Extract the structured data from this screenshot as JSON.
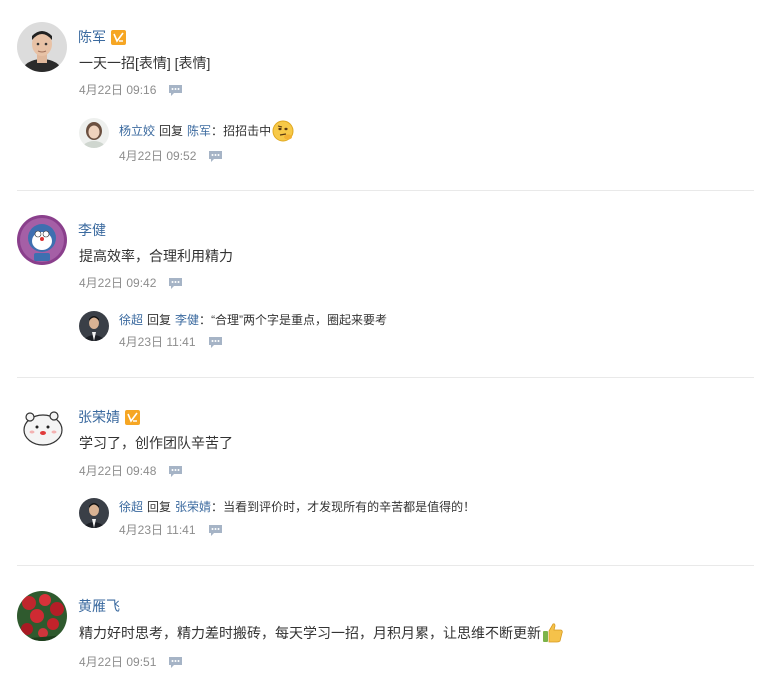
{
  "comments": [
    {
      "author": "陈军",
      "verified": true,
      "text": "一天一招[表情] [表情]",
      "time": "4月22日 09:16",
      "avatar_icon": "portrait-man-avatar",
      "reply": {
        "author": "杨立姣",
        "reply_word": "回复",
        "target": "陈军",
        "colon": "：",
        "text": "招招击中",
        "emoji": "thinking-face-emoji",
        "time": "4月22日 09:52",
        "avatar_icon": "woman-avatar"
      }
    },
    {
      "author": "李健",
      "verified": false,
      "text": "提高效率，合理利用精力",
      "time": "4月22日 09:42",
      "avatar_icon": "cartoon-cat-avatar",
      "reply": {
        "author": "徐超",
        "reply_word": "回复",
        "target": "李健",
        "colon": "：",
        "text": "“合理”两个字是重点，圈起来要考",
        "time": "4月23日 11:41",
        "avatar_icon": "suit-man-avatar"
      }
    },
    {
      "author": "张荣婧",
      "verified": true,
      "text": "学习了，创作团队辛苦了",
      "time": "4月22日 09:48",
      "avatar_icon": "cartoon-bear-avatar",
      "reply": {
        "author": "徐超",
        "reply_word": "回复",
        "target": "张荣婧",
        "colon": "：",
        "text": "当看到评价时，才发现所有的辛苦都是值得的！",
        "time": "4月23日 11:41",
        "avatar_icon": "suit-man-avatar"
      }
    },
    {
      "author": "黄雁飞",
      "verified": false,
      "text": "精力好时思考，精力差时搬砖，每天学习一招，月积月累，让思维不断更新",
      "emoji": "thumbs-up-emoji",
      "time": "4月22日 09:51",
      "avatar_icon": "flowers-avatar"
    }
  ],
  "colors": {
    "name_link": "#3b6a9f",
    "meta_text": "#8d8d8d",
    "badge": "#f6a623",
    "divider": "#e9e9e9"
  }
}
